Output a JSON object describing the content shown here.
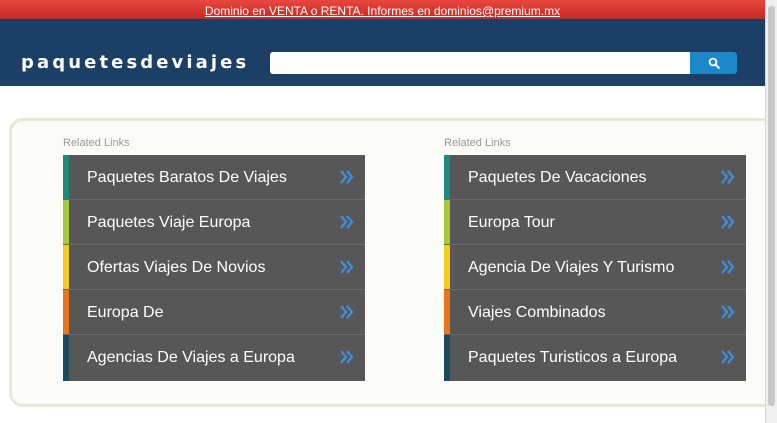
{
  "topbar": {
    "text": "Dominio en VENTA o RENTA. Informes en dominios@premium.mx"
  },
  "header": {
    "logo": "paquetesdeviajes",
    "search": {
      "value": "",
      "placeholder": ""
    },
    "search_icon": "search-icon"
  },
  "colors": {
    "header_bg": "#1c3f66",
    "topbar_bg": "#d9342c",
    "link_bg": "#575757",
    "search_btn": "#1d88c8",
    "chevron": "#3e8edb",
    "stripes": [
      "#1e8a7a",
      "#a6c93a",
      "#f2cc1f",
      "#e8741e",
      "#1d4a5e"
    ]
  },
  "columns": [
    {
      "heading": "Related Links",
      "links": [
        {
          "label": "Paquetes Baratos De Viajes"
        },
        {
          "label": "Paquetes Viaje Europa"
        },
        {
          "label": "Ofertas Viajes De Novios"
        },
        {
          "label": "Europa De"
        },
        {
          "label": "Agencias De Viajes a Europa"
        }
      ]
    },
    {
      "heading": "Related Links",
      "links": [
        {
          "label": "Paquetes De Vacaciones"
        },
        {
          "label": "Europa Tour"
        },
        {
          "label": "Agencia De Viajes Y Turismo"
        },
        {
          "label": "Viajes Combinados"
        },
        {
          "label": "Paquetes Turisticos a Europa"
        }
      ]
    }
  ]
}
